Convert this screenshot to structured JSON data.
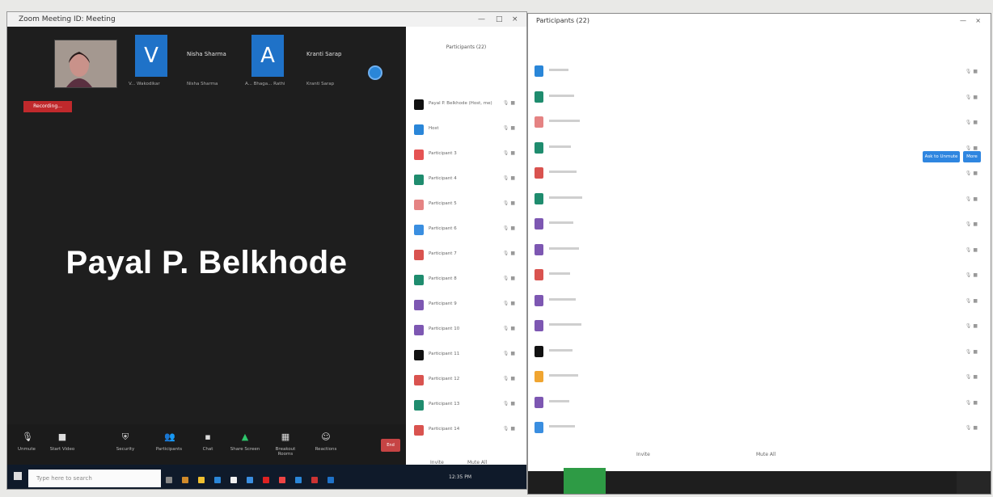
{
  "zoom": {
    "title": "Zoom Meeting ID: Meeting",
    "controls": [
      "—",
      "□",
      "×"
    ],
    "tiles": [
      {
        "letter": "V",
        "name": "",
        "caption": "V... Wakodikar"
      },
      {
        "letter": "",
        "name": "Nisha Sharma",
        "caption": "Nisha Sharma"
      },
      {
        "letter": "A",
        "name": "",
        "caption": "A... Bhaga... Rathi"
      },
      {
        "letter": "",
        "name": "Kranti Sarap",
        "caption": "Kranti Sarap"
      }
    ],
    "recording_label": "Recording...",
    "speaker_name": "Payal P.  Belkhode",
    "toolbar": [
      {
        "icon": "mic-icon",
        "label": "Unmute"
      },
      {
        "icon": "video-icon",
        "label": "Start Video"
      },
      {
        "icon": "security-icon",
        "label": "Security"
      },
      {
        "icon": "participants-icon",
        "label": "Participants"
      },
      {
        "icon": "chat-icon",
        "label": "Chat"
      },
      {
        "icon": "share-screen-icon",
        "label": "Share Screen"
      },
      {
        "icon": "breakout-rooms-icon",
        "label": "Breakout Rooms"
      },
      {
        "icon": "reactions-icon",
        "label": "Reactions"
      }
    ],
    "end_label": "End",
    "participants_title": "Participants (22)",
    "participants": [
      {
        "name": "Payal P. Belkhode (Host, me)",
        "color": "#111111",
        "initial": ""
      },
      {
        "name": "Host",
        "color": "#2a86d8",
        "initial": ""
      },
      {
        "name": "Participant 3",
        "color": "#e55353",
        "initial": ""
      },
      {
        "name": "Participant 4",
        "color": "#1f8c6e",
        "initial": ""
      },
      {
        "name": "Participant 5",
        "color": "#e58383",
        "initial": ""
      },
      {
        "name": "Participant 6",
        "color": "#3a8ee0",
        "initial": ""
      },
      {
        "name": "Participant 7",
        "color": "#d9534f",
        "initial": ""
      },
      {
        "name": "Participant 8",
        "color": "#1f8c6e",
        "initial": ""
      },
      {
        "name": "Participant 9",
        "color": "#7d57b2",
        "initial": ""
      },
      {
        "name": "Participant 10",
        "color": "#7d57b2",
        "initial": ""
      },
      {
        "name": "Participant 11",
        "color": "#111111",
        "initial": ""
      },
      {
        "name": "Participant 12",
        "color": "#d9534f",
        "initial": ""
      },
      {
        "name": "Participant 13",
        "color": "#1f8c6e",
        "initial": ""
      },
      {
        "name": "Participant 14",
        "color": "#d9534f",
        "initial": ""
      }
    ],
    "panel_invite": "Invite",
    "panel_mute_all": "Mute All",
    "taskbar_search": "Type here to search",
    "time": "12:35 PM"
  },
  "right": {
    "title": "Participants (22)",
    "buttons": [
      "Ask to Unmute",
      "More"
    ],
    "participants": [
      {
        "color": "#2a86d8"
      },
      {
        "color": "#1f8c6e"
      },
      {
        "color": "#e58383"
      },
      {
        "color": "#1f8c6e"
      },
      {
        "color": "#d9534f"
      },
      {
        "color": "#1f8c6e"
      },
      {
        "color": "#7d57b2"
      },
      {
        "color": "#7d57b2"
      },
      {
        "color": "#d9534f"
      },
      {
        "color": "#7d57b2"
      },
      {
        "color": "#7d57b2"
      },
      {
        "color": "#111111"
      },
      {
        "color": "#f0a531"
      },
      {
        "color": "#7d57b2"
      },
      {
        "color": "#3a8ee0"
      }
    ],
    "bottom_left": "Invite",
    "bottom_right": "Mute All"
  }
}
